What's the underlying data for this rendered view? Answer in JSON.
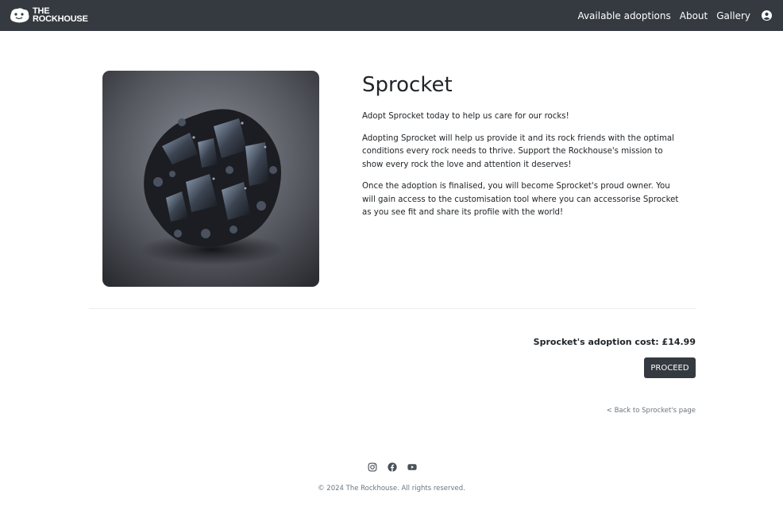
{
  "brand": {
    "line1": "THE",
    "line2": "ROCKHOUSE"
  },
  "nav": {
    "items": [
      "Available adoptions",
      "About",
      "Gallery"
    ],
    "user_icon": "user-circle-icon"
  },
  "rock": {
    "name": "Sprocket",
    "paragraphs": [
      "Adopt Sprocket today to help us care for our rocks!",
      "Adopting Sprocket will help us provide it and its rock friends with the optimal conditions every rock needs to thrive. Support the Rockhouse's mission to show every rock the love and attention it deserves!",
      "Once the adoption is finalised, you will become Sprocket's proud owner. You will gain access to the customisation tool where you can accessorise Sprocket as you see fit and share its profile with the world!"
    ]
  },
  "purchase": {
    "cost_text": "Sprocket's adoption cost: £14.99",
    "proceed_label": "PROCEED",
    "back_link": "< Back to Sprocket's page"
  },
  "footer": {
    "social_icons": [
      "instagram-icon",
      "facebook-icon",
      "youtube-icon"
    ],
    "copyright": "© 2024 The Rockhouse. All rights reserved."
  },
  "colors": {
    "navbar": "#343a40",
    "button": "#343a40",
    "muted_text": "#6c757d"
  }
}
